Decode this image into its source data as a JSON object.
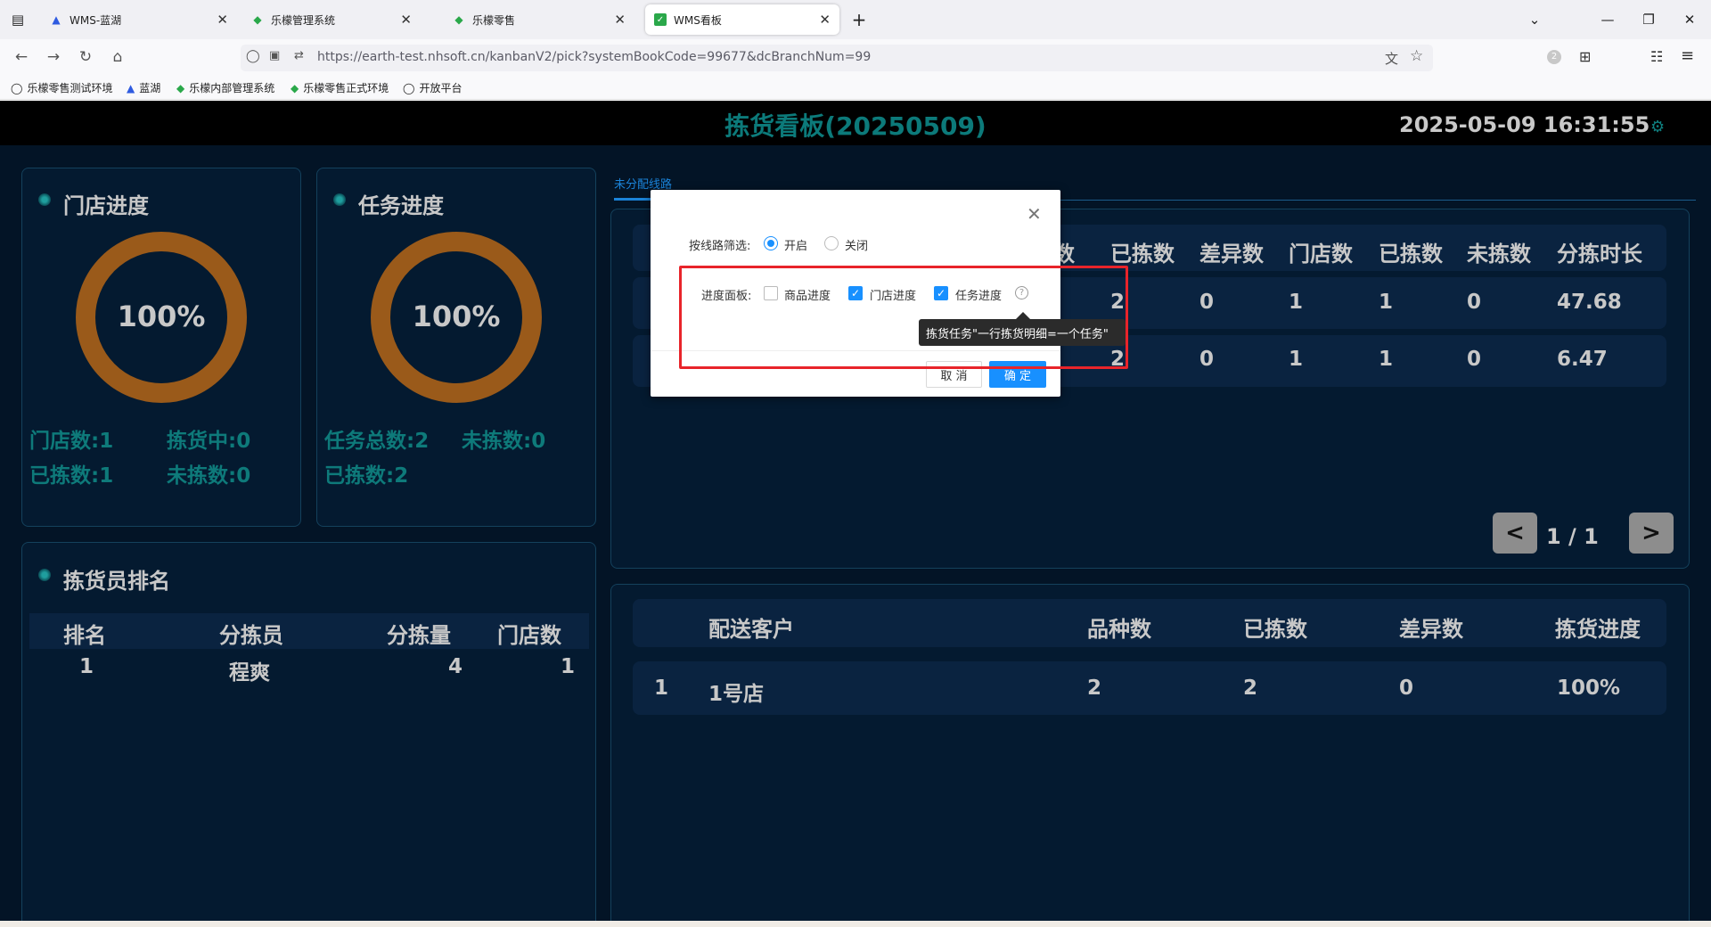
{
  "browser": {
    "tabs": [
      {
        "title": "WMS-蓝湖",
        "icon": "lanhu-icon"
      },
      {
        "title": "乐檬管理系统",
        "icon": "lemeng-icon"
      },
      {
        "title": "乐檬零售",
        "icon": "lemeng-icon"
      },
      {
        "title": "WMS看板",
        "icon": "wms-icon",
        "active": true
      }
    ],
    "url": "https://earth-test.nhsoft.cn/kanbanV2/pick?systemBookCode=99677&dcBranchNum=99",
    "bookmarks": [
      "乐檬零售测试环境",
      "蓝湖",
      "乐檬内部管理系统",
      "乐檬零售正式环境",
      "开放平台"
    ],
    "badge_count": "2"
  },
  "header": {
    "title": "拣货看板(20250509)",
    "datetime": "2025-05-09 16:31:55"
  },
  "store_progress": {
    "title": "门店进度",
    "percent": "100%",
    "stats": [
      "门店数:1",
      "拣货中:0",
      "已拣数:1",
      "未拣数:0"
    ]
  },
  "task_progress": {
    "title": "任务进度",
    "percent": "100%",
    "stats": [
      "任务总数:2",
      "未拣数:0",
      "已拣数:2"
    ]
  },
  "picker_ranking": {
    "title": "拣货员排名",
    "headers": [
      "排名",
      "分拣员",
      "分拣量",
      "门店数"
    ],
    "rows": [
      [
        "1",
        "程爽",
        "4",
        "1"
      ]
    ]
  },
  "route_tabs": {
    "active": "未分配线路"
  },
  "route_table": {
    "headers_visible": [
      "数",
      "已拣数",
      "差异数",
      "门店数",
      "已拣数",
      "未拣数",
      "分拣时长"
    ],
    "rows": [
      [
        "2",
        "0",
        "1",
        "1",
        "0",
        "47.68"
      ],
      [
        "2",
        "0",
        "1",
        "1",
        "0",
        "6.47"
      ]
    ],
    "pagination": {
      "prev": "<",
      "next": ">",
      "label": "1 / 1"
    }
  },
  "customer_table": {
    "headers": [
      "配送客户",
      "品种数",
      "已拣数",
      "差异数",
      "拣货进度"
    ],
    "rows": [
      [
        "1",
        "1号店",
        "2",
        "2",
        "0",
        "100%"
      ]
    ]
  },
  "dialog": {
    "route_filter_label": "按线路筛选:",
    "route_on": "开启",
    "route_off": "关闭",
    "progress_panel_label": "进度面板:",
    "options": [
      "商品进度",
      "门店进度",
      "任务进度"
    ],
    "options_checked": [
      false,
      true,
      true
    ],
    "tooltip": "拣货任务\"一行拣货明细=一个任务\"",
    "cancel": "取 消",
    "ok": "确 定"
  },
  "colors": {
    "page_bg": "#031426",
    "ring": "#9a5a1a",
    "accent_teal": "#0e7a7a",
    "primary_blue": "#1890ff",
    "highlight_red": "#e8242a"
  }
}
